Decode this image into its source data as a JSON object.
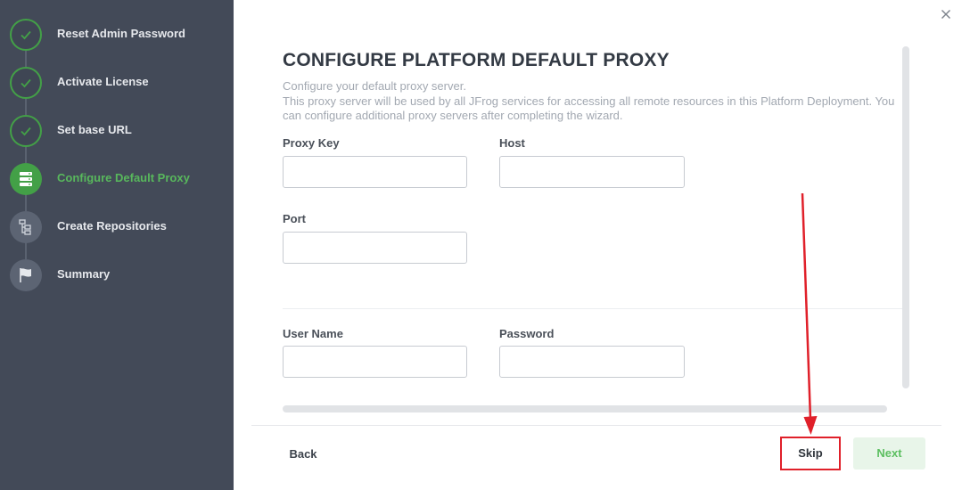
{
  "sidebar": {
    "steps": [
      {
        "label": "Reset Admin Password",
        "state": "done"
      },
      {
        "label": "Activate License",
        "state": "done"
      },
      {
        "label": "Set base URL",
        "state": "done"
      },
      {
        "label": "Configure Default Proxy",
        "state": "active"
      },
      {
        "label": "Create Repositories",
        "state": "todo"
      },
      {
        "label": "Summary",
        "state": "todo"
      }
    ]
  },
  "main": {
    "title": "CONFIGURE PLATFORM DEFAULT PROXY",
    "description_line1": "Configure your default proxy server.",
    "description_line2": "This proxy server will be used by all JFrog services for accessing all remote resources in this Platform Deployment. You can configure additional proxy servers after completing the wizard.",
    "fields": {
      "proxy_key": {
        "label": "Proxy Key",
        "value": ""
      },
      "host": {
        "label": "Host",
        "value": ""
      },
      "port": {
        "label": "Port",
        "value": ""
      },
      "user_name": {
        "label": "User Name",
        "value": ""
      },
      "password": {
        "label": "Password",
        "value": ""
      }
    }
  },
  "footer": {
    "back_label": "Back",
    "skip_label": "Skip",
    "next_label": "Next"
  },
  "colors": {
    "sidebar_bg": "#434a58",
    "accent_green": "#43a047",
    "highlight_red": "#e0202a"
  }
}
